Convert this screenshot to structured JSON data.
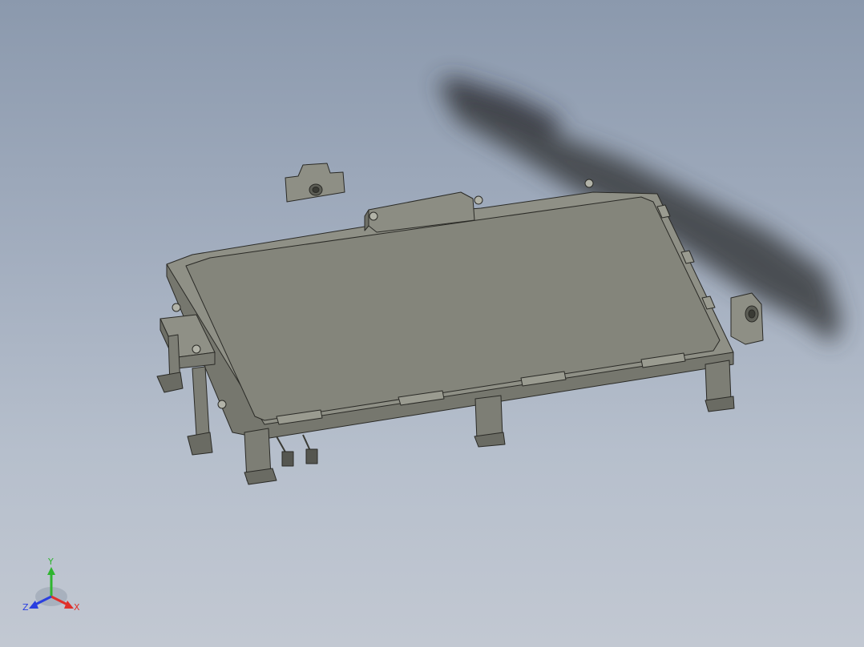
{
  "viewport": {
    "background_top": "#8b99ad",
    "background_bottom": "#c2c8d2"
  },
  "model": {
    "body_color": "#8a8b80",
    "edge_color": "#2a2a26",
    "plate_color": "#84857b"
  },
  "triad": {
    "x_label": "X",
    "y_label": "Y",
    "z_label": "Z",
    "x_color": "#e0302a",
    "y_color": "#2fb52f",
    "z_color": "#2a3fe0"
  }
}
